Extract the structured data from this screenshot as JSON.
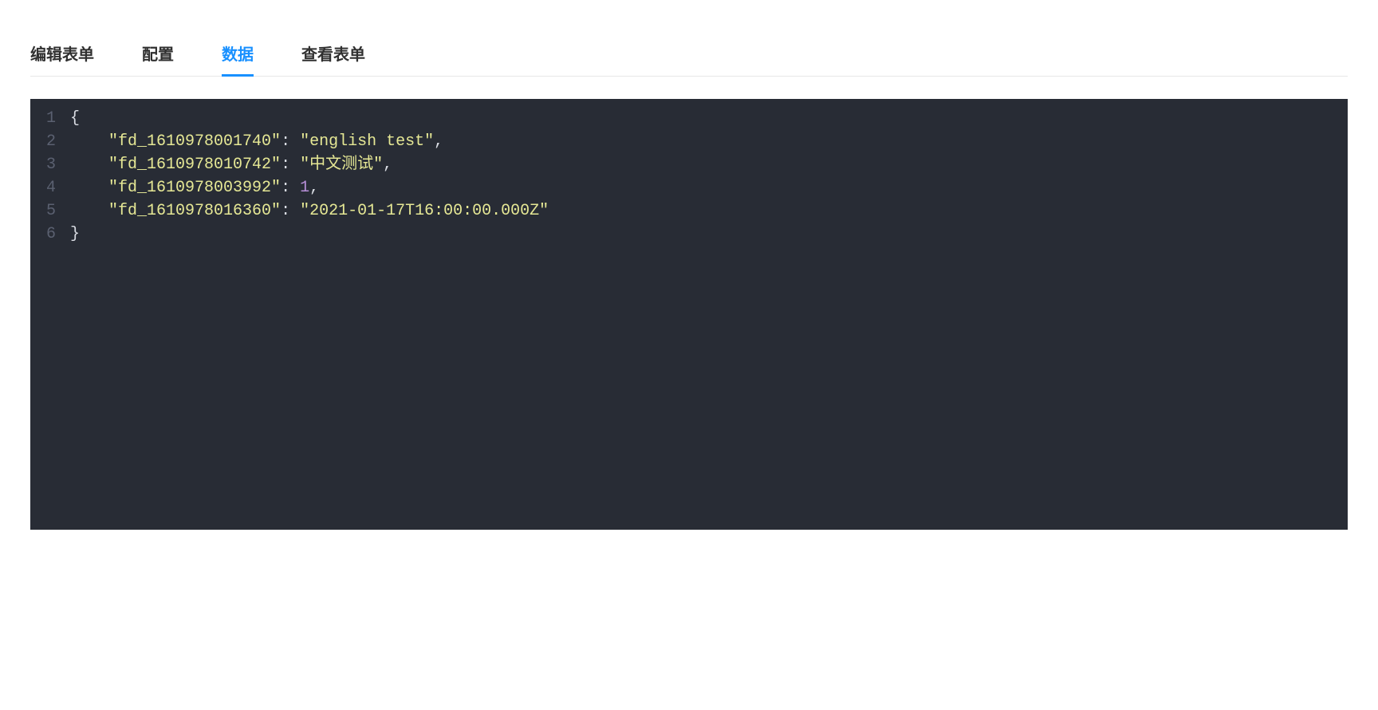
{
  "tabs": [
    {
      "label": "编辑表单",
      "active": false
    },
    {
      "label": "配置",
      "active": false
    },
    {
      "label": "数据",
      "active": true
    },
    {
      "label": "查看表单",
      "active": false
    }
  ],
  "code": {
    "lines": [
      {
        "num": "1",
        "tokens": [
          {
            "t": "{",
            "c": "punct"
          }
        ]
      },
      {
        "num": "2",
        "tokens": [
          {
            "t": "    ",
            "c": "punct"
          },
          {
            "t": "\"fd_1610978001740\"",
            "c": "key"
          },
          {
            "t": ": ",
            "c": "punct"
          },
          {
            "t": "\"english test\"",
            "c": "string"
          },
          {
            "t": ",",
            "c": "punct"
          }
        ]
      },
      {
        "num": "3",
        "tokens": [
          {
            "t": "    ",
            "c": "punct"
          },
          {
            "t": "\"fd_1610978010742\"",
            "c": "key"
          },
          {
            "t": ": ",
            "c": "punct"
          },
          {
            "t": "\"中文测试\"",
            "c": "string"
          },
          {
            "t": ",",
            "c": "punct"
          }
        ]
      },
      {
        "num": "4",
        "tokens": [
          {
            "t": "    ",
            "c": "punct"
          },
          {
            "t": "\"fd_1610978003992\"",
            "c": "key"
          },
          {
            "t": ": ",
            "c": "punct"
          },
          {
            "t": "1",
            "c": "number"
          },
          {
            "t": ",",
            "c": "punct"
          }
        ]
      },
      {
        "num": "5",
        "tokens": [
          {
            "t": "    ",
            "c": "punct"
          },
          {
            "t": "\"fd_1610978016360\"",
            "c": "key"
          },
          {
            "t": ": ",
            "c": "punct"
          },
          {
            "t": "\"2021-01-17T16:00:00.000Z\"",
            "c": "string"
          }
        ]
      },
      {
        "num": "6",
        "tokens": [
          {
            "t": "}",
            "c": "punct"
          }
        ]
      }
    ]
  }
}
